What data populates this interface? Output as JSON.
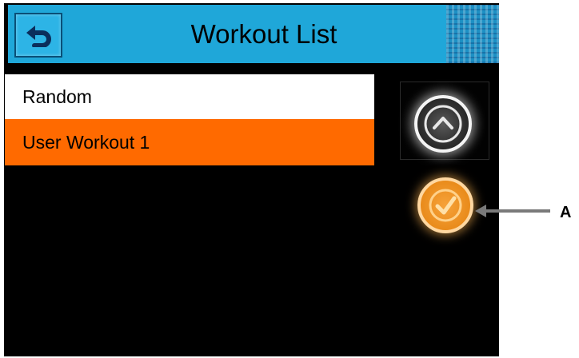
{
  "header": {
    "title": "Workout List"
  },
  "workout_list": {
    "items": [
      {
        "label": "Random",
        "selected": false
      },
      {
        "label": "User Workout 1",
        "selected": true
      }
    ]
  },
  "callout": {
    "label": "A"
  },
  "icons": {
    "back": "back-arrow-icon",
    "up": "chevron-up-icon",
    "confirm": "check-icon"
  },
  "colors": {
    "titlebar": "#1fa7d9",
    "selected_row": "#ff6a00",
    "confirm_button": "#e98b1b",
    "screen_background": "#000000"
  }
}
